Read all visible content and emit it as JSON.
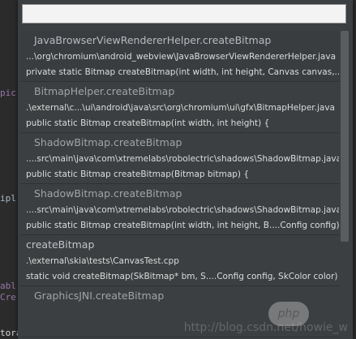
{
  "background_code": {
    "frag1": "pic",
    "frag2": "ipl",
    "frag3": "abl",
    "frag4": "Cre",
    "frag5": "torageObj(),"
  },
  "search": {
    "value": "",
    "placeholder": ""
  },
  "results": [
    {
      "title": "JavaBrowserViewRendererHelper.createBitmap",
      "path": "...\\org\\chromium\\android_webview\\JavaBrowserViewRendererHelper.java",
      "signature": "private static Bitmap createBitmap(int width, int height, Canvas canvas,... ▸"
    },
    {
      "title": "BitmapHelper.createBitmap",
      "path": ".\\external\\c...\\ui\\android\\java\\src\\org\\chromium\\ui\\gfx\\BitmapHelper.java",
      "signature": "public static Bitmap createBitmap(int width, int height) {"
    },
    {
      "title": "ShadowBitmap.createBitmap",
      "path": "....src\\main\\java\\com\\xtremelabs\\robolectric\\shadows\\ShadowBitmap.java",
      "signature": "public static Bitmap createBitmap(Bitmap bitmap) {"
    },
    {
      "title": "ShadowBitmap.createBitmap",
      "path": "....src\\main\\java\\com\\xtremelabs\\robolectric\\shadows\\ShadowBitmap.java",
      "signature": "public static Bitmap createBitmap(int width, int height, B....Config config) {"
    },
    {
      "title": "createBitmap",
      "path": ".\\external\\skia\\tests\\CanvasTest.cpp",
      "signature": "static void createBitmap(SkBitmap* bm, S....Config config, SkColor color) {"
    },
    {
      "title": "GraphicsJNI.createBitmap",
      "path": "",
      "signature": ""
    }
  ],
  "watermark": "http://blog.csdn.net/howie_w",
  "php_badge": "php",
  "colors": {
    "popup_bg": "#3c3f41",
    "input_bg": "#f3f3f3",
    "title_text": "#a0a4a8",
    "detail_text": "#dcdcdc"
  }
}
